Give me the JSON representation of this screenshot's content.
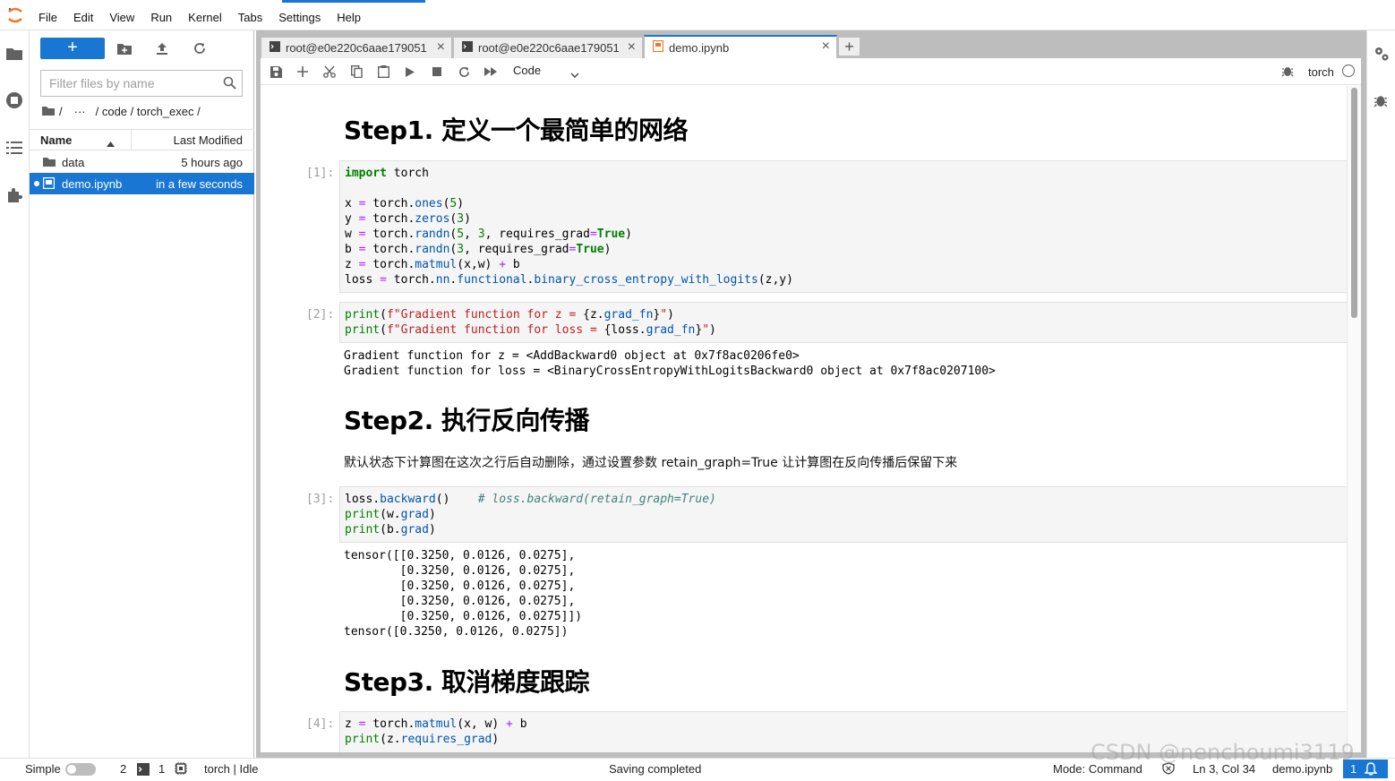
{
  "menubar": {
    "items": [
      "File",
      "Edit",
      "View",
      "Run",
      "Kernel",
      "Tabs",
      "Settings",
      "Help"
    ]
  },
  "filebrowser": {
    "new_label": "+",
    "filter_placeholder": "Filter files by name",
    "breadcrumb": [
      "/",
      "···",
      "/ code / torch_exec /"
    ],
    "columns": {
      "name": "Name",
      "modified": "Last Modified"
    },
    "files": [
      {
        "name": "data",
        "modified": "5 hours ago",
        "type": "folder"
      },
      {
        "name": "demo.ipynb",
        "modified": "in a few seconds",
        "type": "notebook",
        "selected": true
      }
    ]
  },
  "tabs": [
    {
      "label": "root@e0e220c6aae179051",
      "type": "terminal"
    },
    {
      "label": "root@e0e220c6aae179051",
      "type": "terminal"
    },
    {
      "label": "demo.ipynb",
      "type": "notebook",
      "active": true
    }
  ],
  "notebook_toolbar": {
    "cell_type": "Code",
    "kernel": "torch"
  },
  "notebook": {
    "h1_step1": "Step1. 定义一个最简单的网络",
    "h1_step2": "Step2. 执行反向传播",
    "h1_step3": "Step3. 取消梯度跟踪",
    "step2_paragraph": "默认状态下计算图在这次之行后自动删除，通过设置参数 retain_graph=True 让计算图在反向传播后保留下来",
    "prompts": [
      "[1]:",
      "[2]:",
      "[3]:",
      "[4]:"
    ],
    "out2": [
      "Gradient function for z = <AddBackward0 object at 0x7f8ac0206fe0>",
      "Gradient function for loss = <BinaryCrossEntropyWithLogitsBackward0 object at 0x7f8ac0207100>"
    ],
    "out3": [
      "tensor([[0.3250, 0.0126, 0.0275],",
      "        [0.3250, 0.0126, 0.0275],",
      "        [0.3250, 0.0126, 0.0275],",
      "        [0.3250, 0.0126, 0.0275],",
      "        [0.3250, 0.0126, 0.0275]])",
      "tensor([0.3250, 0.0126, 0.0275])"
    ]
  },
  "statusbar": {
    "mode_label": "Simple",
    "terminals": "2",
    "kernels": "1",
    "kernel_status": "torch | Idle",
    "message": "Saving completed",
    "command_mode": "Mode: Command",
    "position": "Ln 3, Col 34",
    "filename": "demo.ipynb",
    "notifications": "1"
  },
  "watermark": "CSDN @nenchoumi3119",
  "colors": {
    "accent": "#1976d2",
    "keyword": "#008000",
    "function": "#0055aa",
    "string": "#ba2121",
    "operator": "#aa22ff"
  }
}
